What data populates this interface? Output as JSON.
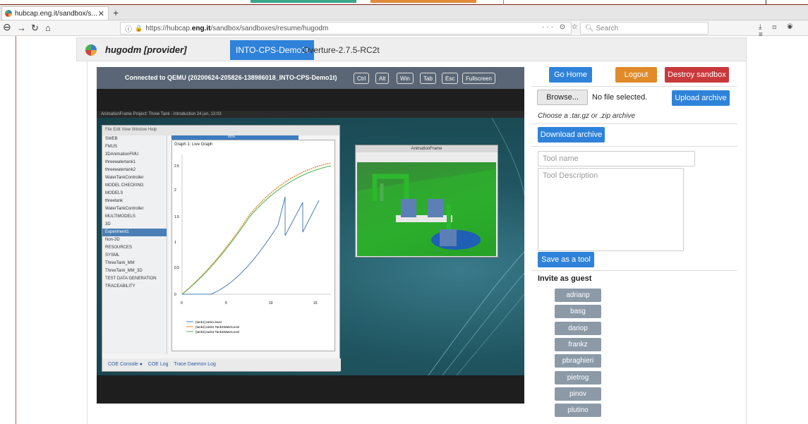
{
  "browser": {
    "tab_title": "hubcap.eng.it/sandbox/s...",
    "url_prefix": "https://hubcap.",
    "url_domain": "eng.it",
    "url_suffix": "/sandbox/sandboxes/resume/hugodm",
    "search_placeholder": "Search",
    "page_icons": "··· ⊙ ☆",
    "right_icons": "⤓ ⊡ ◉ ≡"
  },
  "app": {
    "username": "hugodm [provider]",
    "tabs": [
      {
        "label": "INTO-CPS-Demo1t",
        "active": true
      },
      {
        "label": "Overture-2.7.5-RC2t",
        "active": false
      }
    ]
  },
  "vnc": {
    "title": "Connected to QEMU (20200624-205826-138986018_INTO-CPS-Demo1t)",
    "keys": [
      "Ctrl",
      "Alt",
      "Win",
      "Tab",
      "Esc",
      "Fullscreen"
    ]
  },
  "desktop": {
    "panel_text": "AnimationFrame      Project: Three Tank - Introduction                              24 jun, 13:03",
    "ide_menu": "File  Edit  View  Window  Help",
    "graph_title": "Graph 1: Live Graph",
    "progress_label": "80%",
    "tree": [
      "SWEB",
      "FMUS",
      "3DAnimationFMU",
      "threewatertank1",
      "threewatertank2",
      "WaterTankController",
      "MODEL CHECKING",
      "MODELS",
      "threetank",
      "WaterTankController",
      "MULTIMODELS",
      "3D",
      "Experiment1",
      "Non-3D",
      "RESOURCES",
      "SYSML",
      "ThreeTank_MM",
      "ThreeTank_MM_3D",
      "TEST DATA GENERATION",
      "TRACEABILITY"
    ],
    "y_ticks": [
      "2.5",
      "2",
      "1.5",
      "1",
      "0.5",
      "0"
    ],
    "x_ticks": [
      "0",
      "5",
      "10",
      "15"
    ],
    "legend": [
      "{tank1}.tank1.level",
      "{tank2}.tank2.Tank2WaterLevel",
      "{tank3}.tank3.Tank3WaterLevel"
    ],
    "bottom_tabs": [
      "COE Console ●",
      "COE Log",
      "Trace Daemon Log"
    ],
    "anim_title": "AnimationFrame"
  },
  "sidebar": {
    "go_home": "Go Home",
    "logout": "Logout",
    "destroy": "Destroy sandbox",
    "browse": "Browse...",
    "no_file": "No file selected.",
    "upload": "Upload archive",
    "archive_hint": "Choose a .tar.gz or .zip archive",
    "download": "Download archive",
    "tool_name_placeholder": "Tool name",
    "tool_desc_placeholder": "Tool Description",
    "save_tool": "Save as a tool",
    "invite_heading": "Invite as guest",
    "guests": [
      "adrianp",
      "basg",
      "dariop",
      "frankz",
      "pbraghieri",
      "pietrog",
      "pinov",
      "plutino"
    ]
  },
  "colors": {
    "primary": "#2f82d9",
    "warning": "#e08a2a",
    "danger": "#c9383a",
    "guest": "#8c9aa8"
  }
}
